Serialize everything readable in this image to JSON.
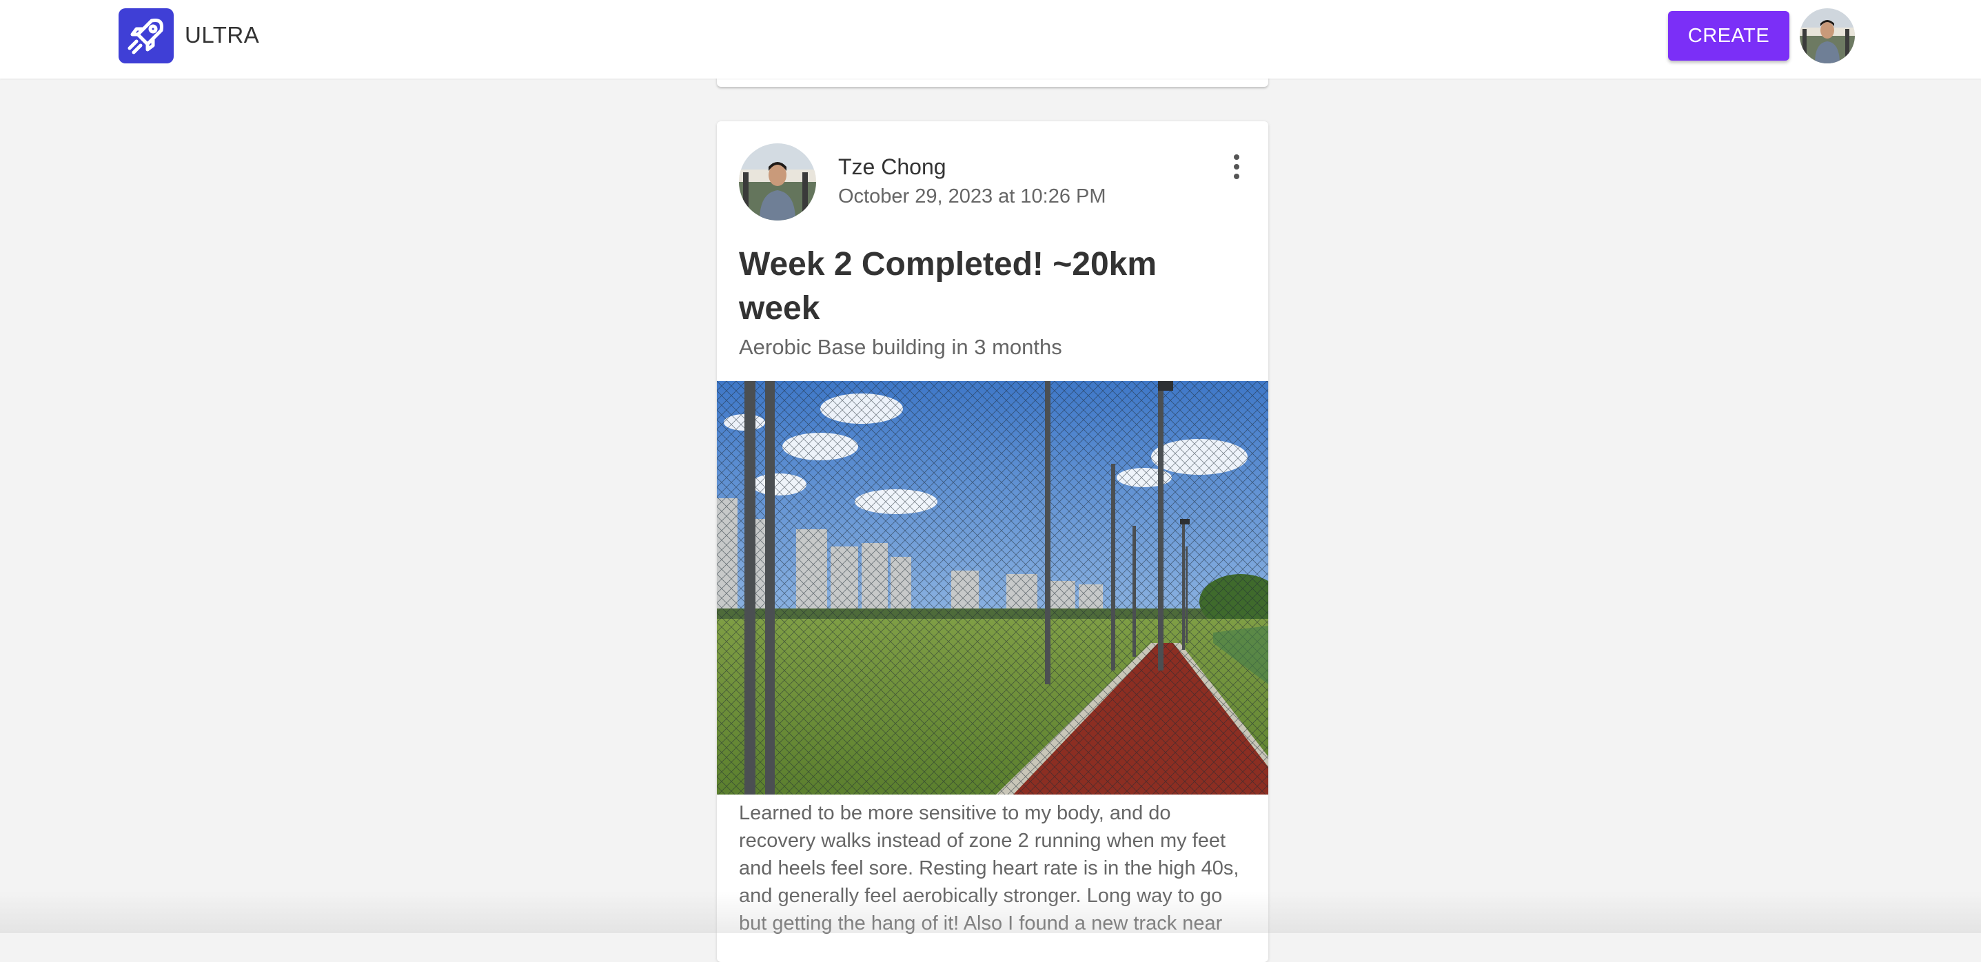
{
  "app": {
    "brand": "ULTRA",
    "create_label": "CREATE",
    "logo_icon": "rocket-logo-icon",
    "accent_color": "#7b2ff7",
    "logo_color": "#3f3fd6"
  },
  "post": {
    "author": "Tze Chong",
    "date": "October 29, 2023 at 10:26 PM",
    "title": "Week 2 Completed! ~20km week",
    "subtitle": "Aerobic Base building in 3 months",
    "body": "Learned to be more sensitive to my body, and do recovery walks instead of zone 2 running when my feet and heels feel sore. Resting heart rate is in the high 40s, and generally feel aerobically stronger. Long way to go but getting the hang of it! Also I found a new track near",
    "menu_icon": "more-vertical-icon"
  }
}
